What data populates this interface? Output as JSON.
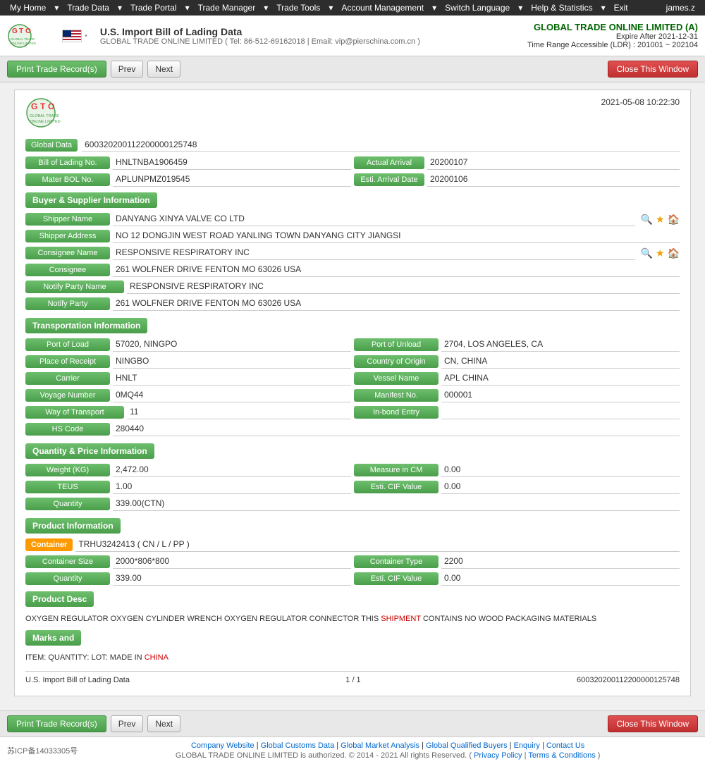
{
  "nav": {
    "items": [
      "My Home",
      "Trade Data",
      "Trade Portal",
      "Trade Manager",
      "Trade Tools",
      "Account Management",
      "Switch Language",
      "Help & Statistics",
      "Exit"
    ],
    "username": "james.z"
  },
  "header": {
    "logo_alt": "GTO Logo",
    "flag_alt": "US Flag",
    "title": "U.S. Import Bill of Lading Data",
    "subtitle_tel": "GLOBAL TRADE ONLINE LIMITED ( Tel: 86-512-69162018 | Email: vip@pierschina.com.cn )",
    "company_name": "GLOBAL TRADE ONLINE LIMITED (A)",
    "expire_label": "Expire After 2021-12-31",
    "time_range": "Time Range Accessible (LDR) : 201001 ~ 202104"
  },
  "toolbar": {
    "print_label": "Print Trade Record(s)",
    "prev_label": "Prev",
    "next_label": "Next",
    "close_label": "Close This Window"
  },
  "card": {
    "date": "2021-05-08 10:22:30",
    "global_data_label": "Global Data",
    "global_data_value": "600320200112200000125748",
    "bill_of_lading_label": "Bill of Lading No.",
    "bill_of_lading_value": "HNLTNBA1906459",
    "actual_arrival_label": "Actual Arrival",
    "actual_arrival_value": "20200107",
    "mater_bol_label": "Mater BOL No.",
    "mater_bol_value": "APLUNPMZ019545",
    "esti_arrival_label": "Esti. Arrival Date",
    "esti_arrival_value": "20200106",
    "buyer_supplier_title": "Buyer & Supplier Information",
    "shipper_name_label": "Shipper Name",
    "shipper_name_value": "DANYANG XINYA VALVE CO LTD",
    "shipper_address_label": "Shipper Address",
    "shipper_address_value": "NO 12 DONGJIN WEST ROAD YANLING TOWN DANYANG CITY JIANGSI",
    "consignee_name_label": "Consignee Name",
    "consignee_name_value": "RESPONSIVE RESPIRATORY INC",
    "consignee_label": "Consignee",
    "consignee_value": "261 WOLFNER DRIVE FENTON MO 63026 USA",
    "notify_party_name_label": "Notify Party Name",
    "notify_party_name_value": "RESPONSIVE RESPIRATORY INC",
    "notify_party_label": "Notify Party",
    "notify_party_value": "261 WOLFNER DRIVE FENTON MO 63026 USA",
    "transportation_title": "Transportation Information",
    "port_of_load_label": "Port of Load",
    "port_of_load_value": "57020, NINGPO",
    "port_of_unload_label": "Port of Unload",
    "port_of_unload_value": "2704, LOS ANGELES, CA",
    "place_of_receipt_label": "Place of Receipt",
    "place_of_receipt_value": "NINGBO",
    "country_of_origin_label": "Country of Origin",
    "country_of_origin_value": "CN, CHINA",
    "carrier_label": "Carrier",
    "carrier_value": "HNLT",
    "vessel_name_label": "Vessel Name",
    "vessel_name_value": "APL CHINA",
    "voyage_number_label": "Voyage Number",
    "voyage_number_value": "0MQ44",
    "manifest_no_label": "Manifest No.",
    "manifest_no_value": "000001",
    "way_of_transport_label": "Way of Transport",
    "way_of_transport_value": "11",
    "in_bond_entry_label": "In-bond Entry",
    "in_bond_entry_value": "",
    "hs_code_label": "HS Code",
    "hs_code_value": "280440",
    "quantity_price_title": "Quantity & Price Information",
    "weight_kg_label": "Weight (KG)",
    "weight_kg_value": "2,472.00",
    "measure_in_cm_label": "Measure in CM",
    "measure_in_cm_value": "0.00",
    "teus_label": "TEUS",
    "teus_value": "1.00",
    "esti_cif_value_label": "Esti. CIF Value",
    "esti_cif_value": "0.00",
    "quantity_label": "Quantity",
    "quantity_value": "339.00(CTN)",
    "product_info_title": "Product Information",
    "container_label": "Container",
    "container_value": "TRHU3242413 ( CN / L / PP )",
    "container_size_label": "Container Size",
    "container_size_value": "2000*806*800",
    "container_type_label": "Container Type",
    "container_type_value": "2200",
    "quantity2_label": "Quantity",
    "quantity2_value": "339.00",
    "esti_cif2_label": "Esti. CIF Value",
    "esti_cif2_value": "0.00",
    "product_desc_label": "Product Desc",
    "product_desc_text1": "OXYGEN REGULATOR OXYGEN CYLINDER WRENCH OXYGEN REGULATOR CONNECTOR THIS ",
    "product_desc_shipment": "SHIPMENT",
    "product_desc_text2": " CONTAINS NO WOOD PACKAGING MATERIALS",
    "marks_and_label": "Marks and",
    "marks_value": "ITEM: QUANTITY: LOT: MADE IN ",
    "marks_china": "CHINA"
  },
  "card_footer": {
    "left": "U.S. Import Bill of Lading Data",
    "middle": "1 / 1",
    "right": "600320200112200000125748"
  },
  "footer": {
    "icp": "苏ICP备14033305号",
    "links": [
      "Company Website",
      "Global Customs Data",
      "Global Market Analysis",
      "Global Qualified Buyers",
      "Enquiry",
      "Contact Us"
    ],
    "copyright": "GLOBAL TRADE ONLINE LIMITED is authorized. © 2014 - 2021 All rights Reserved.  (  Privacy Policy  |  Terms & Conditions  )"
  }
}
